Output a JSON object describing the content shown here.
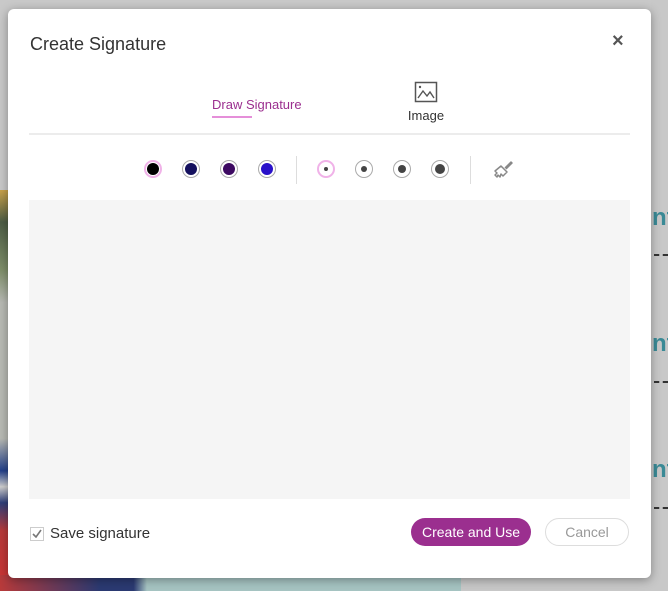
{
  "dialog": {
    "title": "Create Signature",
    "close_label": "×"
  },
  "tabs": [
    {
      "label": "Draw Signature",
      "icon": null,
      "active": true
    },
    {
      "label": "Image",
      "icon": "image-icon",
      "active": false
    }
  ],
  "colors": [
    {
      "name": "black",
      "hex": "#000000",
      "selected": true
    },
    {
      "name": "navy",
      "hex": "#14105e",
      "selected": false
    },
    {
      "name": "purple",
      "hex": "#3d0a62",
      "selected": false
    },
    {
      "name": "blue",
      "hex": "#2810c9",
      "selected": false
    }
  ],
  "stroke_sizes": [
    {
      "name": "extra-small",
      "selected": true
    },
    {
      "name": "small",
      "selected": false
    },
    {
      "name": "medium",
      "selected": false
    },
    {
      "name": "large",
      "selected": false
    }
  ],
  "clear_tool": {
    "icon": "brush-icon"
  },
  "footer": {
    "save_signature_label": "Save signature",
    "save_signature_checked": true,
    "create_label": "Create and Use",
    "cancel_label": "Cancel"
  },
  "accent_color": "#9b2f8f",
  "background": {
    "text_fragment": "nf"
  }
}
